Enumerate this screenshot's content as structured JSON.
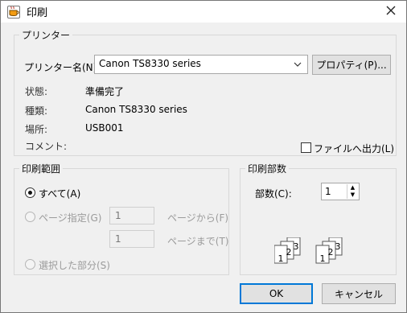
{
  "window": {
    "title": "印刷",
    "close": "✕"
  },
  "printer": {
    "group_label": "プリンター",
    "name_label": "プリンター名(N):",
    "selected_printer": "Canon TS8330 series",
    "properties_button": "プロパティ(P)...",
    "status_label": "状態:",
    "status_value": "準備完了",
    "type_label": "種類:",
    "type_value": "Canon TS8330 series",
    "location_label": "場所:",
    "location_value": "USB001",
    "comment_label": "コメント:",
    "print_to_file_label": "ファイルへ出力(L)"
  },
  "range": {
    "group_label": "印刷範囲",
    "all_label": "すべて(A)",
    "pages_label": "ページ指定(G)",
    "from_value": "1",
    "from_label": "ページから(F)",
    "to_value": "1",
    "to_label": "ページまで(T)",
    "selection_label": "選択した部分(S)"
  },
  "copies": {
    "group_label": "印刷部数",
    "copies_label": "部数(C):",
    "copies_value": "1"
  },
  "buttons": {
    "ok": "OK",
    "cancel": "キャンセル"
  },
  "illustration": {
    "page1": "1",
    "page2": "2",
    "page3": "3"
  },
  "colors": {
    "accent": "#0078d7"
  },
  "icons": {
    "app": "java-cup-icon",
    "close": "close-icon",
    "dropdown": "chevron-down-icon",
    "spin_up": "arrow-up-icon",
    "spin_down": "arrow-down-icon"
  }
}
